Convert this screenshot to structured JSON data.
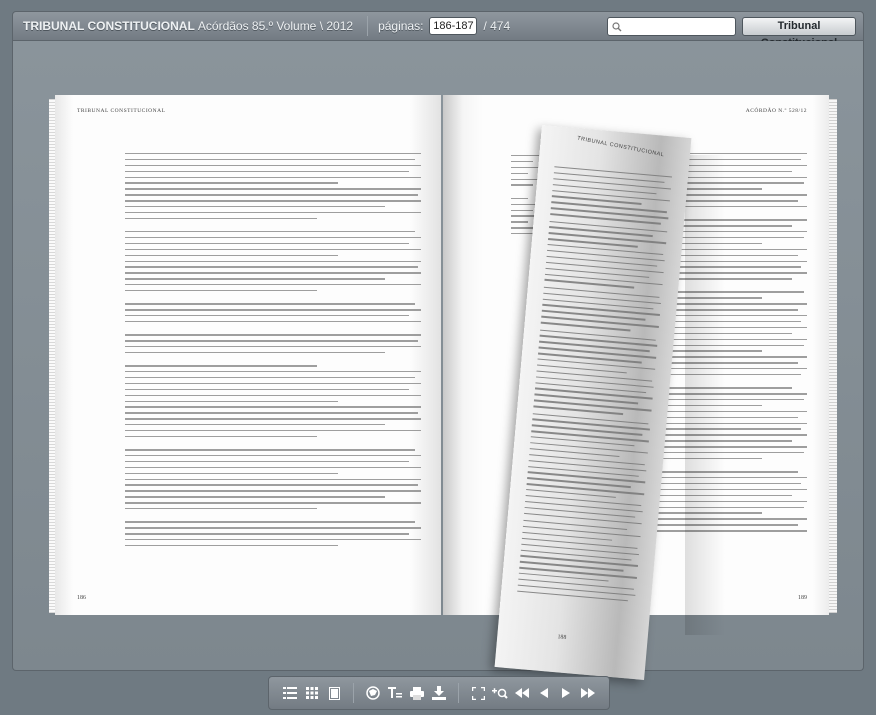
{
  "header": {
    "title_bold": "TRIBUNAL CONSTITUCIONAL",
    "title_rest": "Acórdãos 85.º Volume \\ 2012",
    "pages_label": "páginas:",
    "current_pages": "186-187",
    "total_pages": "/ 474",
    "search_placeholder": "",
    "site_button": "Tribunal Constitucional"
  },
  "book": {
    "left_running_head": "TRIBUNAL CONSTITUCIONAL",
    "right_running_head": "ACÓRDÃO N.º 528/12",
    "curl_running_head": "TRIBUNAL CONSTITUCIONAL",
    "left_folio": "186",
    "right_folio": "189",
    "curl_folio": "188"
  },
  "toolbar": {
    "icons": [
      "list-icon",
      "grid-icon",
      "single-page-icon",
      "share-icon",
      "text-icon",
      "print-icon",
      "download-icon",
      "fullscreen-icon",
      "zoom-icon",
      "first-page-icon",
      "previous-page-icon",
      "next-page-icon",
      "last-page-icon"
    ]
  }
}
